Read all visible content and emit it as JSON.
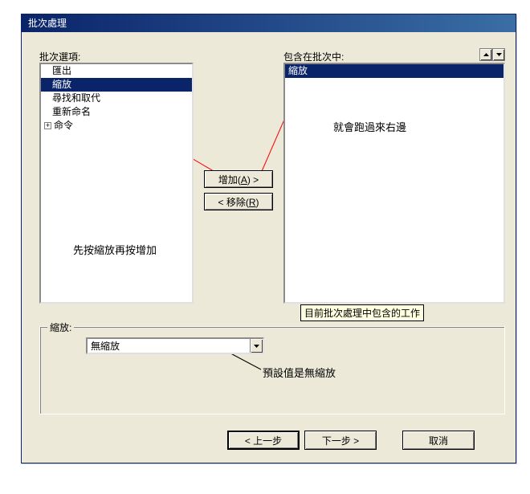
{
  "window": {
    "title": "批次處理"
  },
  "labels": {
    "batchOptions": "批次選項:",
    "includedInBatch": "包含在批次中:"
  },
  "leftList": {
    "items": [
      {
        "label": "匯出",
        "selected": false
      },
      {
        "label": "縮放",
        "selected": true
      },
      {
        "label": "尋找和取代",
        "selected": false
      },
      {
        "label": "重新命名",
        "selected": false
      }
    ],
    "treeItem": {
      "label": "命令"
    }
  },
  "rightList": {
    "items": [
      {
        "label": "縮放",
        "selected": true
      }
    ]
  },
  "buttons": {
    "add": {
      "prefix": "增加(",
      "hotkey": "A",
      "suffix": ") >"
    },
    "remove": {
      "prefix": "< 移除(",
      "hotkey": "R",
      "suffix": ")"
    },
    "back": "< 上一步",
    "next": "下一步 >",
    "cancel": "取消"
  },
  "group": {
    "label": "縮放:",
    "comboValue": "無縮放"
  },
  "tooltip": "目前批次處理中包含的工作",
  "annotations": {
    "rightNote": "就會跑過來右邊",
    "leftNote": "先按縮放再按增加",
    "bottomNote": "預設值是無縮放"
  }
}
